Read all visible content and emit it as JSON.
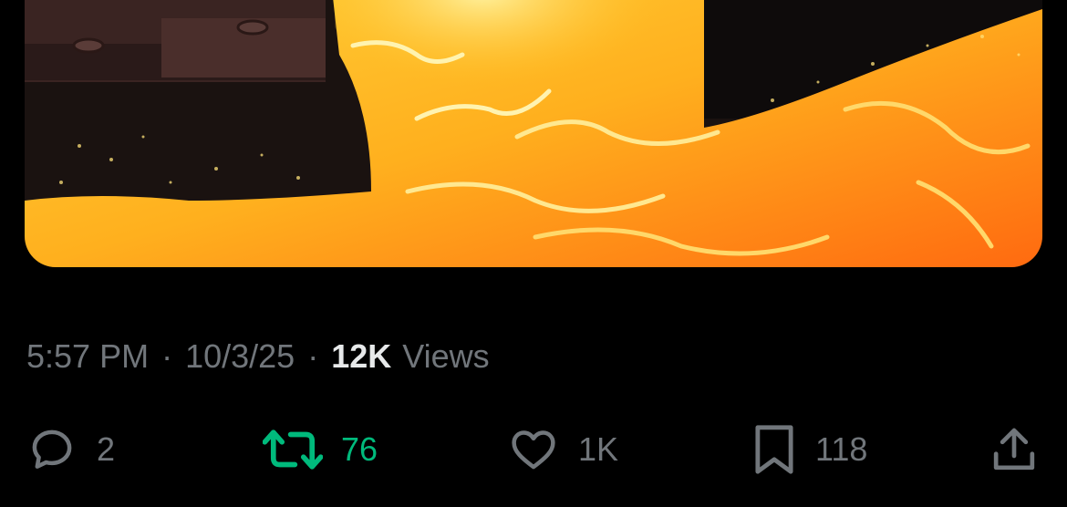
{
  "post": {
    "time": "5:57 PM",
    "date": "10/3/25",
    "views_count": "12K",
    "views_label": "Views",
    "separator": "·"
  },
  "actions": {
    "replies": "2",
    "reposts": "76",
    "likes": "1K",
    "bookmarks": "118"
  },
  "colors": {
    "background": "#000000",
    "muted_text": "#71767b",
    "primary_text": "#e7e9ea",
    "repost_active": "#00ba7c"
  },
  "icons": {
    "reply": "speech-bubble-icon",
    "repost": "repost-arrows-icon",
    "like": "heart-icon",
    "bookmark": "bookmark-icon",
    "share": "share-upload-icon"
  }
}
